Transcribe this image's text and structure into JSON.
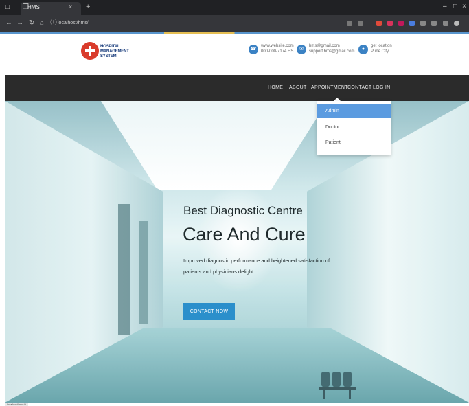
{
  "browser": {
    "tab_title": "HMS",
    "url": "localhost/hms/",
    "tab_close": "×",
    "new_tab": "+"
  },
  "site": {
    "logo_lines": [
      "HOSPITAL",
      "MANAGEMENT",
      "SYSTEM"
    ],
    "contacts": [
      {
        "icon": "phone-icon",
        "line1": "www.website.com",
        "line2": "000-000-7174 HS"
      },
      {
        "icon": "mail-icon",
        "line1": "hms@gmail.com",
        "line2": "support.hms@gmail.com"
      },
      {
        "icon": "location-icon",
        "line1": "get location",
        "line2": "Pune City"
      }
    ]
  },
  "nav": {
    "items": [
      "HOME",
      "ABOUT",
      "APPOINTMENT",
      "CONTACT",
      "LOG IN"
    ]
  },
  "dropdown": {
    "items": [
      "Admin",
      "Doctor",
      "Patient"
    ],
    "active_index": 0
  },
  "hero": {
    "subtitle": "Best Diagnostic Centre",
    "title": "Care And Cure",
    "description": "Improved diagnostic performance and heightened satisfaction of patients and physicians delight.",
    "button_label": "CONTACT NOW"
  },
  "status_hint": "localhost/hms/#",
  "colors": {
    "accent": "#2b8fcb",
    "navbar": "#2b2b2b",
    "dropdown_active": "#5b9be0",
    "logo_red": "#d93b2b"
  }
}
